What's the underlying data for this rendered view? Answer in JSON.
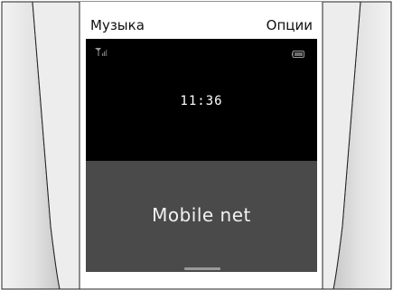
{
  "softkeys": {
    "left_label": "Музыка",
    "right_label": "Опции"
  },
  "status": {
    "signal": "signal-icon",
    "battery": "battery-icon"
  },
  "idle_screen": {
    "time": "11:36",
    "network_name": "Mobile net"
  },
  "colors": {
    "screen_background": "#000000",
    "network_panel": "#4a4a4a",
    "text": "#ffffff",
    "bezel": "#d9d9d9"
  }
}
